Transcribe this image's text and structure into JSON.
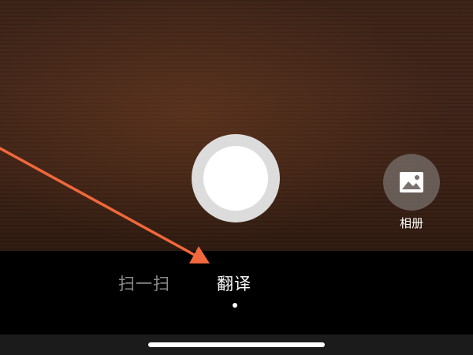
{
  "camera": {
    "album_label": "相册",
    "album_icon": "image-icon",
    "shutter_icon": "shutter-button"
  },
  "modes": {
    "items": [
      {
        "label": "扫一扫",
        "selected": false
      },
      {
        "label": "翻译",
        "selected": true
      }
    ]
  },
  "annotation": {
    "arrow_color": "#f0683c"
  },
  "colors": {
    "viewfinder": "#3b2216",
    "mode_active": "#ffffff",
    "mode_inactive": "#8a8a8a",
    "bottom_bar": "#000000"
  }
}
